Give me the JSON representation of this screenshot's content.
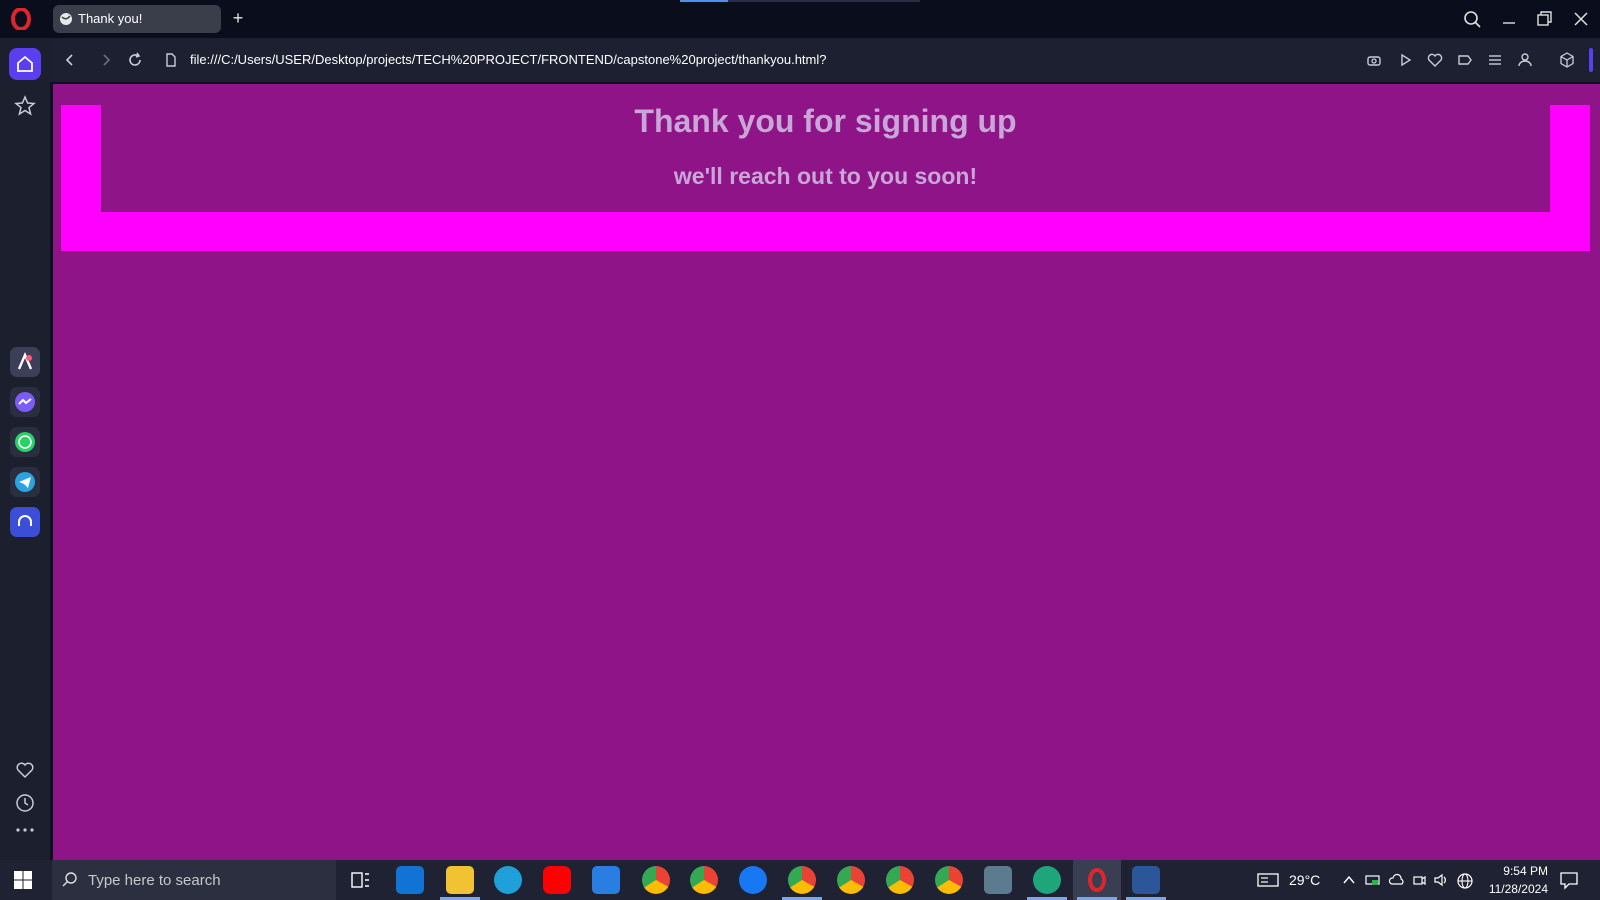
{
  "browser": {
    "tab_title": "Thank you!",
    "new_tab_symbol": "+",
    "url": "file:///C:/Users/USER/Desktop/projects/TECH%20PROJECT/FRONTEND/capstone%20project/thankyou.html?"
  },
  "page": {
    "heading": "Thank you for signing up",
    "subheading": "we'll reach out to you soon!"
  },
  "taskbar": {
    "search_placeholder": "Type here to search",
    "weather": "29°C",
    "time": "9:54 PM",
    "date": "11/28/2024"
  },
  "colors": {
    "page_bg": "#8f1487",
    "band": "#ff00ff",
    "heading_text": "#c9a6d8",
    "accent": "#5a3ef0"
  }
}
